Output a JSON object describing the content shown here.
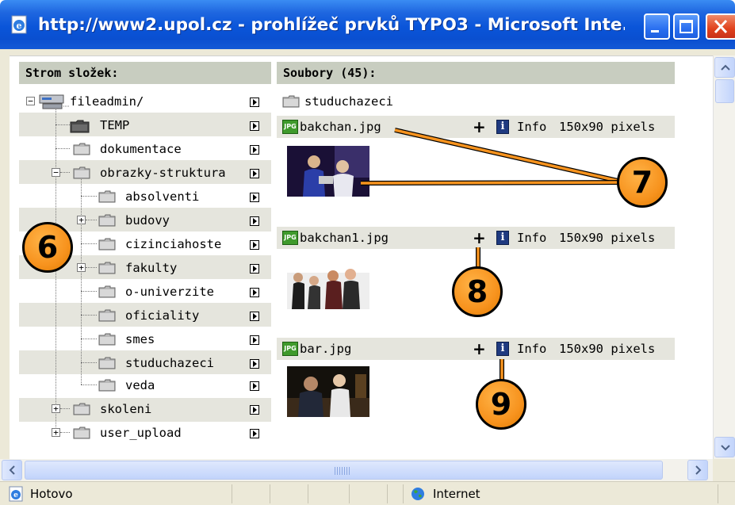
{
  "window": {
    "title": "http://www2.upol.cz - prohlížeč prvků TYPO3 - Microsoft Inte...",
    "icon": "ie-page-icon"
  },
  "folder_tree": {
    "header": "Strom složek:",
    "items": [
      {
        "label": "fileadmin/",
        "icon": "server-icon",
        "expander": "minus"
      },
      {
        "label": "TEMP",
        "icon": "folder-dark-icon"
      },
      {
        "label": "dokumentace",
        "icon": "folder-icon"
      },
      {
        "label": "obrazky-struktura",
        "icon": "folder-icon",
        "expander": "minus"
      },
      {
        "label": "absolventi",
        "icon": "folder-icon"
      },
      {
        "label": "budovy",
        "icon": "folder-icon",
        "expander": "plus"
      },
      {
        "label": "cizinciahoste",
        "icon": "folder-icon"
      },
      {
        "label": "fakulty",
        "icon": "folder-icon",
        "expander": "plus"
      },
      {
        "label": "o-univerzite",
        "icon": "folder-icon"
      },
      {
        "label": "oficiality",
        "icon": "folder-icon"
      },
      {
        "label": "smes",
        "icon": "folder-icon"
      },
      {
        "label": "studuchazeci",
        "icon": "folder-icon"
      },
      {
        "label": "veda",
        "icon": "folder-icon"
      },
      {
        "label": "skoleni",
        "icon": "folder-icon",
        "expander": "plus"
      },
      {
        "label": "user_upload",
        "icon": "folder-icon",
        "expander": "plus"
      }
    ]
  },
  "files": {
    "header": "Soubory (45):",
    "subfolder": "studuchazeci",
    "items": [
      {
        "name": "bakchan.jpg",
        "add": "+",
        "info": "Info",
        "size": "150x90 pixels",
        "icon_text": "JPG"
      },
      {
        "name": "bakchan1.jpg",
        "add": "+",
        "info": "Info",
        "size": "150x90 pixels",
        "icon_text": "JPG"
      },
      {
        "name": "bar.jpg",
        "add": "+",
        "info": "Info",
        "size": "150x90 pixels",
        "icon_text": "JPG"
      }
    ]
  },
  "callouts": {
    "six": "6",
    "seven": "7",
    "eight": "8",
    "nine": "9"
  },
  "statusbar": {
    "status": "Hotovo",
    "zone": "Internet"
  },
  "colors": {
    "titlebar": "#0a55d9",
    "callout": "#f7931e",
    "header_bg": "#c8cdc0",
    "row_stripe": "#e5e5dd",
    "jpg_icon": "#3f9a2c"
  }
}
